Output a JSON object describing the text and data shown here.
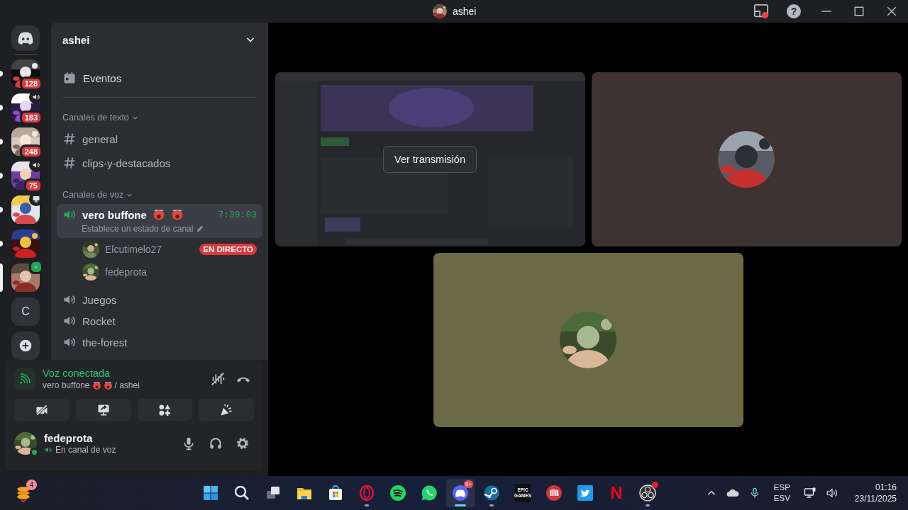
{
  "window": {
    "title": "ashei",
    "help": "?"
  },
  "servers": [
    {
      "kind": "picture",
      "badge": "128",
      "unread": true,
      "selected": false,
      "voice": false,
      "screen": false,
      "connected": false
    },
    {
      "kind": "picture",
      "badge": "183",
      "unread": true,
      "selected": false,
      "voice": true,
      "screen": false,
      "connected": false
    },
    {
      "kind": "picture",
      "badge": "248",
      "unread": true,
      "selected": false,
      "voice": false,
      "screen": false,
      "connected": false
    },
    {
      "kind": "picture",
      "badge": "75",
      "unread": true,
      "selected": false,
      "voice": true,
      "screen": false,
      "connected": false
    },
    {
      "kind": "picture",
      "unread": true,
      "selected": false,
      "voice": false,
      "screen": true,
      "connected": false
    },
    {
      "kind": "picture",
      "unread": true,
      "selected": false,
      "voice": false,
      "screen": false,
      "connected": false
    },
    {
      "kind": "picture",
      "unread": false,
      "selected": true,
      "voice": true,
      "screen": false,
      "connected": true
    },
    {
      "kind": "letter",
      "label": "C",
      "unread": false,
      "selected": false,
      "voice": false,
      "screen": false,
      "connected": false
    },
    {
      "kind": "add",
      "unread": false,
      "selected": false,
      "voice": false,
      "screen": false,
      "connected": false
    }
  ],
  "sidebar": {
    "title": "ashei",
    "events": "Eventos",
    "categories": [
      {
        "title": "Canales de texto",
        "channels": [
          {
            "kind": "text",
            "name": "general",
            "selected": false
          },
          {
            "kind": "text",
            "name": "clips-y-destacados",
            "selected": false
          }
        ]
      },
      {
        "title": "Canales de voz",
        "channels": [
          {
            "kind": "voice",
            "name": "vero buffone",
            "selected": true,
            "timer": "7:39:03",
            "status": "Establece un estado de canal",
            "members": [
              {
                "name": "Elcutimelo27",
                "live": "EN DIRECTO"
              },
              {
                "name": "fedeprota"
              }
            ]
          },
          {
            "kind": "voice",
            "name": "Juegos",
            "selected": false
          },
          {
            "kind": "voice",
            "name": "Rocket",
            "selected": false
          },
          {
            "kind": "voice",
            "name": "the-forest",
            "selected": false
          }
        ]
      }
    ]
  },
  "voice_panel": {
    "status": "Voz conectada",
    "channel": "vero buffone",
    "server": "/ ashei"
  },
  "user": {
    "name": "fedeprota",
    "status": "En canal de voz",
    "online": true
  },
  "stage": {
    "tiles": [
      {
        "kind": "stream",
        "button": "Ver transmisión"
      },
      {
        "kind": "avatar",
        "color": "#3e3332"
      },
      {
        "kind": "avatar",
        "color": "#6b6a46"
      }
    ]
  },
  "taskbar": {
    "widget_badge": "4",
    "apps": [
      {
        "kind": "start",
        "running": false,
        "active": false,
        "alert": false
      },
      {
        "kind": "search",
        "running": false,
        "active": false,
        "alert": false
      },
      {
        "kind": "taskview",
        "running": false,
        "active": false,
        "alert": false
      },
      {
        "kind": "folder",
        "running": false,
        "active": false,
        "alert": false
      },
      {
        "kind": "store",
        "running": false,
        "active": false,
        "alert": false
      },
      {
        "kind": "opera",
        "running": true,
        "active": false,
        "alert": false
      },
      {
        "kind": "spotify",
        "running": false,
        "active": false,
        "alert": false
      },
      {
        "kind": "whatsapp",
        "running": false,
        "active": false,
        "alert": false
      },
      {
        "kind": "discord",
        "running": true,
        "active": true,
        "alert": false,
        "badge": "9+"
      },
      {
        "kind": "steam",
        "running": true,
        "active": false,
        "alert": false
      },
      {
        "kind": "epic",
        "label": "EPIC GAMES",
        "running": false,
        "active": false,
        "alert": false
      },
      {
        "kind": "riot",
        "running": false,
        "active": false,
        "alert": false
      },
      {
        "kind": "twitter",
        "running": false,
        "active": false,
        "alert": false
      },
      {
        "kind": "netflix",
        "label": "N",
        "running": false,
        "active": false,
        "alert": false
      },
      {
        "kind": "obs",
        "running": true,
        "active": false,
        "alert": true
      }
    ],
    "language": "ESP",
    "layout": "ESV",
    "time": "01:16",
    "date": "23/11/2025"
  }
}
